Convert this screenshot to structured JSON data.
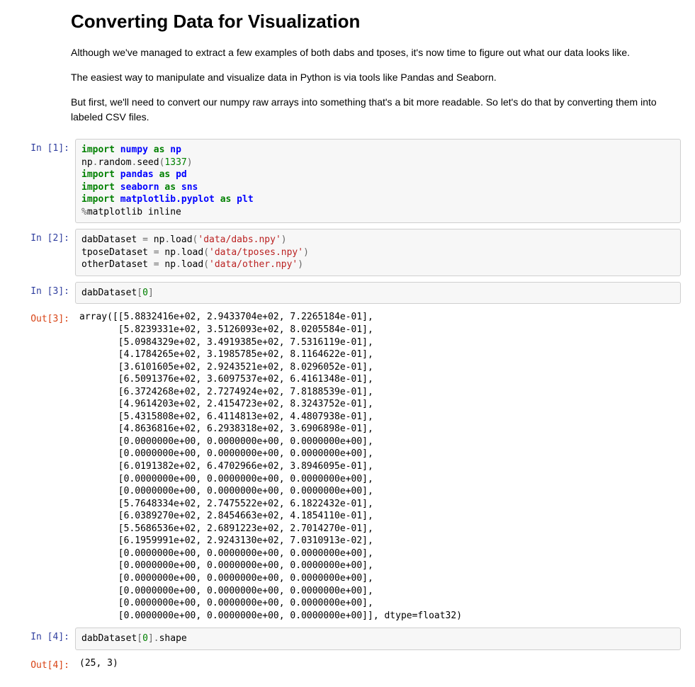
{
  "markdown": {
    "heading": "Converting Data for Visualization",
    "p1": "Although we've managed to extract a few examples of both dabs and tposes, it's now time to figure out what our data looks like.",
    "p2": "The easiest way to manipulate and visualize data in Python is via tools like Pandas and Seaborn.",
    "p3": "But first, we'll need to convert our numpy raw arrays into something that's a bit more readable. So let's do that by converting them into labeled CSV files."
  },
  "cells": {
    "in1_prompt": "In [1]:",
    "in1": {
      "l1_import": "import",
      "l1_numpy": "numpy",
      "l1_as": "as",
      "l1_np": "np",
      "l2_np": "np",
      "l2_dot1": ".",
      "l2_random": "random",
      "l2_dot2": ".",
      "l2_seed": "seed",
      "l2_open": "(",
      "l2_num": "1337",
      "l2_close": ")",
      "l3_import": "import",
      "l3_pandas": "pandas",
      "l3_as": "as",
      "l3_pd": "pd",
      "l4_import": "import",
      "l4_seaborn": "seaborn",
      "l4_as": "as",
      "l4_sns": "sns",
      "l5_import": "import",
      "l5_mpl": "matplotlib.pyplot",
      "l5_as": "as",
      "l5_plt": "plt",
      "l6_pct": "%",
      "l6_rest": "matplotlib inline"
    },
    "in2_prompt": "In [2]:",
    "in2": {
      "l1_var": "dabDataset ",
      "l1_eq": "=",
      "l1_np": " np",
      "l1_dot": ".",
      "l1_load": "load",
      "l1_open": "(",
      "l1_str": "'data/dabs.npy'",
      "l1_close": ")",
      "l2_var": "tposeDataset ",
      "l2_eq": "=",
      "l2_np": " np",
      "l2_dot": ".",
      "l2_load": "load",
      "l2_open": "(",
      "l2_str": "'data/tposes.npy'",
      "l2_close": ")",
      "l3_var": "otherDataset ",
      "l3_eq": "=",
      "l3_np": " np",
      "l3_dot": ".",
      "l3_load": "load",
      "l3_open": "(",
      "l3_str": "'data/other.npy'",
      "l3_close": ")"
    },
    "in3_prompt": "In [3]:",
    "in3": {
      "var": "dabDataset",
      "open": "[",
      "num": "0",
      "close": "]"
    },
    "out3_prompt": "Out[3]:",
    "out3_text": "array([[5.8832416e+02, 2.9433704e+02, 7.2265184e-01],\n       [5.8239331e+02, 3.5126093e+02, 8.0205584e-01],\n       [5.0984329e+02, 3.4919385e+02, 7.5316119e-01],\n       [4.1784265e+02, 3.1985785e+02, 8.1164622e-01],\n       [3.6101605e+02, 2.9243521e+02, 8.0296052e-01],\n       [6.5091376e+02, 3.6097537e+02, 6.4161348e-01],\n       [6.3724268e+02, 2.7274924e+02, 7.8188539e-01],\n       [4.9614203e+02, 2.4154723e+02, 8.3243752e-01],\n       [5.4315808e+02, 6.4114813e+02, 4.4807938e-01],\n       [4.8636816e+02, 6.2938318e+02, 3.6906898e-01],\n       [0.0000000e+00, 0.0000000e+00, 0.0000000e+00],\n       [0.0000000e+00, 0.0000000e+00, 0.0000000e+00],\n       [6.0191382e+02, 6.4702966e+02, 3.8946095e-01],\n       [0.0000000e+00, 0.0000000e+00, 0.0000000e+00],\n       [0.0000000e+00, 0.0000000e+00, 0.0000000e+00],\n       [5.7648334e+02, 2.7475522e+02, 6.1822432e-01],\n       [6.0389270e+02, 2.8454663e+02, 4.1854110e-01],\n       [5.5686536e+02, 2.6891223e+02, 2.7014270e-01],\n       [6.1959991e+02, 2.9243130e+02, 7.0310913e-02],\n       [0.0000000e+00, 0.0000000e+00, 0.0000000e+00],\n       [0.0000000e+00, 0.0000000e+00, 0.0000000e+00],\n       [0.0000000e+00, 0.0000000e+00, 0.0000000e+00],\n       [0.0000000e+00, 0.0000000e+00, 0.0000000e+00],\n       [0.0000000e+00, 0.0000000e+00, 0.0000000e+00],\n       [0.0000000e+00, 0.0000000e+00, 0.0000000e+00]], dtype=float32)",
    "in4_prompt": "In [4]:",
    "in4": {
      "var": "dabDataset",
      "open": "[",
      "num": "0",
      "close": "]",
      "dot": ".",
      "shape": "shape"
    },
    "out4_prompt": "Out[4]:",
    "out4_text": "(25, 3)"
  }
}
